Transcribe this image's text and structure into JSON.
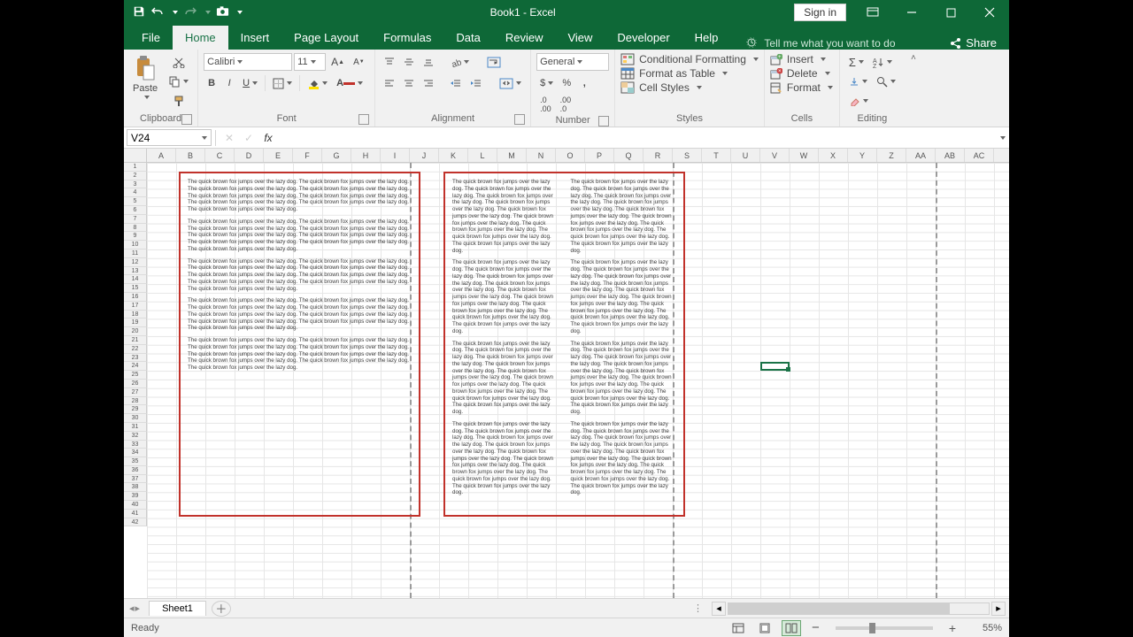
{
  "title": "Book1 - Excel",
  "signin": "Sign in",
  "tabs": [
    "File",
    "Home",
    "Insert",
    "Page Layout",
    "Formulas",
    "Data",
    "Review",
    "View",
    "Developer",
    "Help"
  ],
  "active_tab": 1,
  "tell_me": "Tell me what you want to do",
  "share": "Share",
  "ribbon": {
    "clipboard": {
      "paste": "Paste",
      "label": "Clipboard"
    },
    "font": {
      "name": "Calibri",
      "size": "11",
      "label": "Font"
    },
    "alignment": {
      "label": "Alignment"
    },
    "number": {
      "format": "General",
      "label": "Number"
    },
    "styles": {
      "cond": "Conditional Formatting",
      "table": "Format as Table",
      "cell": "Cell Styles",
      "label": "Styles"
    },
    "cells": {
      "insert": "Insert",
      "delete": "Delete",
      "format": "Format",
      "label": "Cells"
    },
    "editing": {
      "label": "Editing"
    }
  },
  "namebox": "V24",
  "formula": "",
  "columns": [
    "A",
    "B",
    "C",
    "D",
    "E",
    "F",
    "G",
    "H",
    "I",
    "J",
    "K",
    "L",
    "M",
    "N",
    "O",
    "P",
    "Q",
    "R",
    "S",
    "T",
    "U",
    "V",
    "W",
    "X",
    "Y",
    "Z",
    "AA",
    "AB",
    "AC"
  ],
  "row_count": 42,
  "active_cell": {
    "col": 21,
    "row": 24
  },
  "page_break_cols": [
    9,
    18,
    27
  ],
  "textbox_para": "The quick brown fox jumps over the lazy dog.  The quick brown fox jumps over the lazy dog.  The quick brown fox jumps over the lazy dog.  The quick brown fox jumps over the lazy dog.  The quick brown fox jumps over the lazy dog.  The quick brown fox jumps over the lazy dog.  The quick brown fox jumps over the lazy dog.  The quick brown fox jumps over the lazy dog.  The quick brown fox jumps over the lazy dog.",
  "sheet_tab": "Sheet1",
  "status": "Ready",
  "zoom": "55%"
}
